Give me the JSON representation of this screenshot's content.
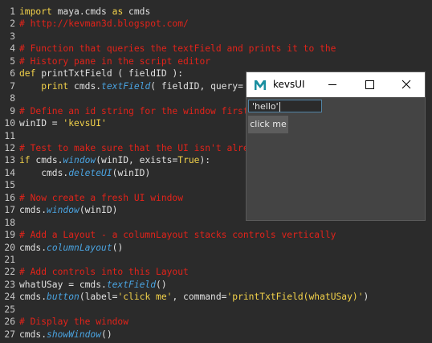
{
  "editor": {
    "lines": [
      {
        "n": "1",
        "segs": [
          {
            "t": "import",
            "c": "kw"
          },
          {
            "t": " maya.cmds ",
            "c": ""
          },
          {
            "t": "as",
            "c": "kw"
          },
          {
            "t": " cmds",
            "c": ""
          }
        ]
      },
      {
        "n": "2",
        "segs": [
          {
            "t": "# http://kevman3d.blogspot.com/",
            "c": "cm"
          }
        ]
      },
      {
        "n": "3",
        "segs": []
      },
      {
        "n": "4",
        "segs": [
          {
            "t": "# Function that queries the textField and prints it to the",
            "c": "cm"
          }
        ]
      },
      {
        "n": "5",
        "segs": [
          {
            "t": "# History pane in the script editor",
            "c": "cm"
          }
        ]
      },
      {
        "n": "6",
        "segs": [
          {
            "t": "def",
            "c": "kw"
          },
          {
            "t": " printTxtField ( fieldID ):",
            "c": ""
          }
        ]
      },
      {
        "n": "7",
        "segs": [
          {
            "t": "    ",
            "c": ""
          },
          {
            "t": "print",
            "c": "kw"
          },
          {
            "t": " cmds.",
            "c": ""
          },
          {
            "t": "textField",
            "c": "fn"
          },
          {
            "t": "( fieldID, query=",
            "c": ""
          }
        ]
      },
      {
        "n": "8",
        "segs": []
      },
      {
        "n": "9",
        "segs": [
          {
            "t": "# Define an id string for the window first",
            "c": "cm"
          }
        ]
      },
      {
        "n": "10",
        "segs": [
          {
            "t": "winID = ",
            "c": ""
          },
          {
            "t": "'kevsUI'",
            "c": "st"
          }
        ]
      },
      {
        "n": "11",
        "segs": []
      },
      {
        "n": "12",
        "segs": [
          {
            "t": "# Test to make sure that the UI isn't already active",
            "c": "cm"
          }
        ]
      },
      {
        "n": "13",
        "segs": [
          {
            "t": "if",
            "c": "kw"
          },
          {
            "t": " cmds.",
            "c": ""
          },
          {
            "t": "window",
            "c": "fn"
          },
          {
            "t": "(winID, exists=",
            "c": ""
          },
          {
            "t": "True",
            "c": "bi"
          },
          {
            "t": "):",
            "c": ""
          }
        ]
      },
      {
        "n": "14",
        "segs": [
          {
            "t": "    cmds.",
            "c": ""
          },
          {
            "t": "deleteUI",
            "c": "fn"
          },
          {
            "t": "(winID)",
            "c": ""
          }
        ]
      },
      {
        "n": "15",
        "segs": []
      },
      {
        "n": "16",
        "segs": [
          {
            "t": "# Now create a fresh UI window",
            "c": "cm"
          }
        ]
      },
      {
        "n": "17",
        "segs": [
          {
            "t": "cmds.",
            "c": ""
          },
          {
            "t": "window",
            "c": "fn"
          },
          {
            "t": "(winID)",
            "c": ""
          }
        ]
      },
      {
        "n": "18",
        "segs": []
      },
      {
        "n": "19",
        "segs": [
          {
            "t": "# Add a Layout - a columnLayout stacks controls vertically",
            "c": "cm"
          }
        ]
      },
      {
        "n": "20",
        "segs": [
          {
            "t": "cmds.",
            "c": ""
          },
          {
            "t": "columnLayout",
            "c": "fn"
          },
          {
            "t": "()",
            "c": ""
          }
        ]
      },
      {
        "n": "21",
        "segs": []
      },
      {
        "n": "22",
        "segs": [
          {
            "t": "# Add controls into this Layout",
            "c": "cm"
          }
        ]
      },
      {
        "n": "23",
        "segs": [
          {
            "t": "whatUSay = cmds.",
            "c": ""
          },
          {
            "t": "textField",
            "c": "fn"
          },
          {
            "t": "()",
            "c": ""
          }
        ]
      },
      {
        "n": "24",
        "segs": [
          {
            "t": "cmds.",
            "c": ""
          },
          {
            "t": "button",
            "c": "fn"
          },
          {
            "t": "(label=",
            "c": ""
          },
          {
            "t": "'click me'",
            "c": "st"
          },
          {
            "t": ", command=",
            "c": ""
          },
          {
            "t": "'printTxtField(whatUSay)'",
            "c": "st"
          },
          {
            "t": ")",
            "c": ""
          }
        ]
      },
      {
        "n": "25",
        "segs": []
      },
      {
        "n": "26",
        "segs": [
          {
            "t": "# Display the window",
            "c": "cm"
          }
        ]
      },
      {
        "n": "27",
        "segs": [
          {
            "t": "cmds.",
            "c": ""
          },
          {
            "t": "showWindow",
            "c": "fn"
          },
          {
            "t": "()",
            "c": ""
          }
        ]
      }
    ]
  },
  "window": {
    "title": "kevsUI",
    "icon": "maya-app-icon",
    "text_field_value": "'hello'",
    "button_label": "click me"
  },
  "colors": {
    "editor_bg": "#2b2b2b",
    "comment": "#e2231a",
    "keyword": "#f3d24a",
    "function": "#4aa3e0",
    "window_bg": "#444444",
    "field_border": "#5285a6"
  }
}
